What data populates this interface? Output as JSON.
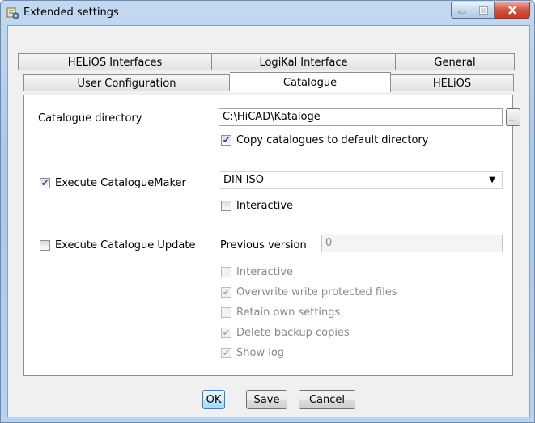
{
  "window": {
    "title": "Extended settings",
    "icon": "settings-app-icon"
  },
  "tabs": {
    "row_back": [
      {
        "label": "HELiOS Interfaces"
      },
      {
        "label": "LogiKal Interface"
      },
      {
        "label": "General"
      }
    ],
    "row_front": [
      {
        "label": "User Configuration"
      },
      {
        "label": "Catalogue",
        "active": true
      },
      {
        "label": "HELiOS"
      }
    ]
  },
  "catalogue": {
    "directory_label": "Catalogue directory",
    "directory_value": "C:\\HiCAD\\Kataloge",
    "browse_label": "...",
    "copy_label": "Copy catalogues to default directory",
    "copy_checked": true,
    "maker_label": "Execute CatalogueMaker",
    "maker_checked": true,
    "maker_value": "DIN ISO",
    "maker_interactive_label": "Interactive",
    "maker_interactive_checked": false,
    "update_label": "Execute Catalogue Update",
    "update_checked": false,
    "prev_version_label": "Previous version",
    "prev_version_value": "0",
    "update_options": [
      {
        "label": "Interactive",
        "checked": false
      },
      {
        "label": "Overwrite write protected files",
        "checked": true
      },
      {
        "label": "Retain own settings",
        "checked": false
      },
      {
        "label": "Delete backup copies",
        "checked": true
      },
      {
        "label": "Show log",
        "checked": true
      }
    ]
  },
  "buttons": {
    "ok": "OK",
    "save": "Save",
    "cancel": "Cancel"
  },
  "colors": {
    "title_gradient": "#aac7e8",
    "close_button": "#c23c27",
    "default_button_border": "#3c7fb1"
  }
}
